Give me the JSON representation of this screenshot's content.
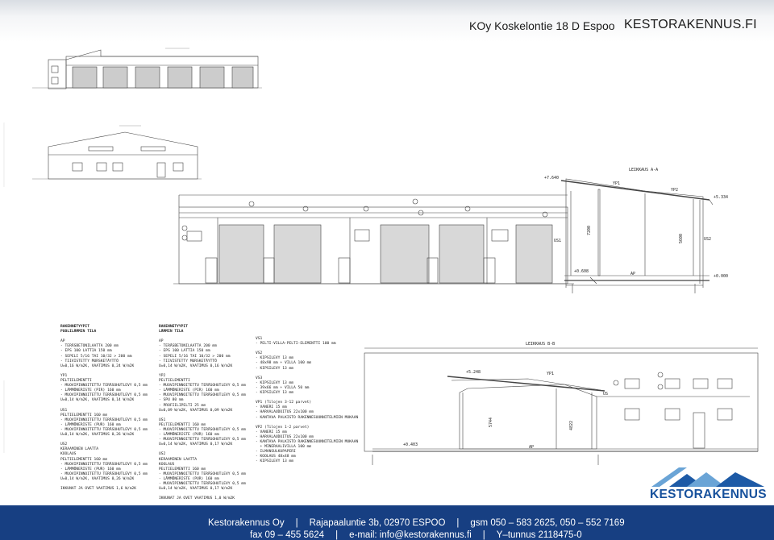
{
  "header": {
    "property": "KOy Koskelontie 18 D Espoo",
    "brand": "KESTORAKENNUS.FI"
  },
  "drawing": {
    "section_a_title": "LEIKKAUS A-A",
    "section_b_title": "LEIKKAUS B-B",
    "sec_a_labels": [
      "YP1",
      "YP2",
      "US1",
      "US2",
      "AP",
      "7200",
      "5600",
      "+7.640",
      "+5.334",
      "+0.608",
      "+0.000"
    ],
    "sec_b_labels": [
      "YP1",
      "US",
      "5744",
      "4822",
      "AP",
      "+5.248",
      "+0.403"
    ],
    "notes_col1": [
      {
        "t": "RAKENNETYYPIT",
        "b": true
      },
      {
        "t": "PUOLILÄMMIN TILA",
        "b": true
      },
      {
        "t": ""
      },
      {
        "t": "AP"
      },
      {
        "t": "- TERÄSBETONILAATTA 200 mm"
      },
      {
        "t": "- EPS 100 LATTIA 150 mm"
      },
      {
        "t": "- SEPELI 5/16 TAI 10/32 > 200 mm"
      },
      {
        "t": "- TIIVISTETTY MURSKETÄYTTÖ"
      },
      {
        "t": "U=0,16 W/m2K, VAATIMUS 0,24 W/m2K"
      },
      {
        "t": ""
      },
      {
        "t": "YP1"
      },
      {
        "t": "PELTIELEMENTTI"
      },
      {
        "t": "- MUOVIPINNOITETTU TERÄSOHUTLEVY 0,5 mm"
      },
      {
        "t": "- LÄMMÖNERISTE (PIR) 160 mm"
      },
      {
        "t": "- MUOVIPINNOITETTU TERÄSOHUTLEVY 0,5 mm"
      },
      {
        "t": "U=0,14 W/m2K, VAATIMUS 0,14 W/m2K"
      },
      {
        "t": ""
      },
      {
        "t": "US1"
      },
      {
        "t": "PELTIELEMENTTI 160 mm"
      },
      {
        "t": "- MUOVIPINNOITETTU TERÄSOHUTLEVY 0,5 mm"
      },
      {
        "t": "- LÄMMÖNERISTE (PUR) 160 mm"
      },
      {
        "t": "- MUOVIPINNOITETTU TERÄSOHUTLEVY 0,5 mm"
      },
      {
        "t": "U=0,14 W/m2K, VAATIMUS 0,26 W/m2K"
      },
      {
        "t": ""
      },
      {
        "t": "US2"
      },
      {
        "t": "KERAAMINEN LAATTA"
      },
      {
        "t": "KOOLAUS"
      },
      {
        "t": "PELTIELEMENTTI 160 mm"
      },
      {
        "t": "- MUOVIPINNOITETTU TERÄSOHUTLEVY 0,5 mm"
      },
      {
        "t": "- LÄMMÖNERISTE (PUR) 160 mm"
      },
      {
        "t": "- MUOVIPINNOITETTU TERÄSOHUTLEVY 0,5 mm"
      },
      {
        "t": "U=0,14 W/m2K, VAATIMUS 0,26 W/m2K"
      },
      {
        "t": ""
      },
      {
        "t": "IKKUNAT JA OVET VAATIMUS 1,6 W/m2K"
      }
    ],
    "notes_col2": [
      {
        "t": "RAKENNETYYPIT",
        "b": true
      },
      {
        "t": "LÄMMIN TILA",
        "b": true
      },
      {
        "t": ""
      },
      {
        "t": "AP"
      },
      {
        "t": "- TERÄSBETONILAATTA 200 mm"
      },
      {
        "t": "- EPS 100 LATTIA 150 mm"
      },
      {
        "t": "- SEPELI 5/16 TAI 10/32 > 200 mm"
      },
      {
        "t": "- TIIVISTETTY MURSKETÄYTTÖ"
      },
      {
        "t": "U=0,14 W/m2K, VAATIMUS 0,16 W/m2K"
      },
      {
        "t": ""
      },
      {
        "t": "YP2"
      },
      {
        "t": "PELTIELEMENTTI"
      },
      {
        "t": "- MUOVIPINNOITETTU TERÄSOHUTLEVY 0,5 mm"
      },
      {
        "t": "- LÄMMÖNERISTE (PIR) 160 mm"
      },
      {
        "t": "- MUOVIPINNOITETTU TERÄSOHUTLEVY 0,5 mm"
      },
      {
        "t": "- SPU 80 mm"
      },
      {
        "t": "- PROFIILIPELTI 25 mm"
      },
      {
        "t": "U=0,09 W/m2K, VAATIMUS 0,09 W/m2K"
      },
      {
        "t": ""
      },
      {
        "t": "US1"
      },
      {
        "t": "PELTIELEMENTTI 160 mm"
      },
      {
        "t": "- MUOVIPINNOITETTU TERÄSOHUTLEVY 0,5 mm"
      },
      {
        "t": "- LÄMMÖNERISTE (PUR) 160 mm"
      },
      {
        "t": "- MUOVIPINNOITETTU TERÄSOHUTLEVY 0,5 mm"
      },
      {
        "t": "U=0,14 W/m2K, VAATIMUS 0,17 W/m2K"
      },
      {
        "t": ""
      },
      {
        "t": "US2"
      },
      {
        "t": "KERAAMINEN LAATTA"
      },
      {
        "t": "KOOLAUS"
      },
      {
        "t": "PELTIELEMENTTI 160 mm"
      },
      {
        "t": "- MUOVIPINNOITETTU TERÄSOHUTLEVY 0,5 mm"
      },
      {
        "t": "- LÄMMÖNERISTE (PUR) 160 mm"
      },
      {
        "t": "- MUOVIPINNOITETTU TERÄSOHUTLEVY 0,5 mm"
      },
      {
        "t": "U=0,14 W/m2K, VAATIMUS 0,17 W/m2K"
      },
      {
        "t": ""
      },
      {
        "t": "IKKUNAT JA OVET VAATIMUS 1,0 W/m2K"
      }
    ],
    "notes_col3": [
      {
        "t": "VS1"
      },
      {
        "t": "- PELTI-VILLA-PELTI-ELEMENTTI 100 mm"
      },
      {
        "t": ""
      },
      {
        "t": "VS2"
      },
      {
        "t": "- KIPSILEVY 13 mm"
      },
      {
        "t": "- 48x98 mm + VILLA 100 mm"
      },
      {
        "t": "- KIPSILEVY 13 mm"
      },
      {
        "t": ""
      },
      {
        "t": "VS3"
      },
      {
        "t": "- KIPSILEVY 13 mm"
      },
      {
        "t": "- 39x66 mm + VILLA 50 mm"
      },
      {
        "t": "- KIPSILEVY 13 mm"
      },
      {
        "t": ""
      },
      {
        "t": "VP1 (Tilojen 3-12 parvet)"
      },
      {
        "t": "- VANERI 15 mm"
      },
      {
        "t": "- HARVALAUDOITUS 22x100 mm"
      },
      {
        "t": "- KANTAVA PALKISTO RAKENNESUUNNITELMIEN MUKAAN"
      },
      {
        "t": ""
      },
      {
        "t": "VP2 (Tilojen 1-2 parvet)"
      },
      {
        "t": "- VANERI 15 mm"
      },
      {
        "t": "- HARVALAUDOITUS 22x100 mm"
      },
      {
        "t": "- KANTAVA PALKISTO RAKENNESUUNNITELMIEN MUKAAN"
      },
      {
        "t": "  + MINERAALIVILLA 100 mm"
      },
      {
        "t": "- ILMANSULKUPAPERI"
      },
      {
        "t": "- KOOLAUS 48x48 mm"
      },
      {
        "t": "- KIPSILEVY 13 mm"
      }
    ]
  },
  "logo": {
    "text": "KESTORAKENNUS",
    "colors": {
      "roof_light": "#6aa4d6",
      "roof_dark": "#1d5aa6",
      "text": "#17519c"
    }
  },
  "footer": {
    "company": "Kestorakennus Oy",
    "address": "Rajapaaluntie 3b, 02970 ESPOO",
    "gsm": "gsm 050 – 583 2625,   050 – 552 7169",
    "fax": "fax 09 – 455 5624",
    "email": "e-mail: info@kestorakennus.fi",
    "ytunnus": "Y–tunnus 2118475-0",
    "bg_color": "#173f82"
  }
}
